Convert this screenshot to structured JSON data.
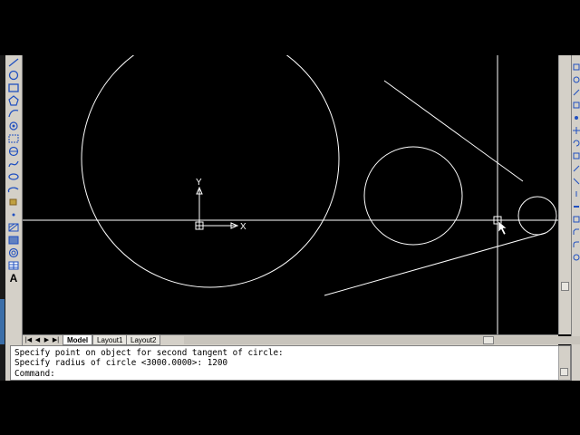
{
  "layout_tabs": {
    "model": "Model",
    "layout1": "Layout1",
    "layout2": "Layout2"
  },
  "ucs": {
    "x_label": "X",
    "y_label": "Y"
  },
  "command_window": {
    "line1": "Specify point on object for second tangent of circle:",
    "line2": "Specify radius of circle <3000.0000>: 1200",
    "line3": "Command:"
  },
  "toolbar": {
    "text_tool": "A"
  },
  "icons": {
    "left_toolbar": [
      "line-icon",
      "circle-icon",
      "rectangle-icon",
      "polygon-icon",
      "arc-icon",
      "revision-cloud-icon",
      "spline-icon",
      "ellipse-icon",
      "ellipse-arc-icon",
      "insert-block-icon",
      "make-block-icon",
      "point-icon",
      "hatch-icon",
      "gradient-icon",
      "region-icon",
      "table-icon",
      "multiline-text-icon"
    ]
  },
  "colors": {
    "canvas": "#000000",
    "geometry": "#ffffff",
    "chrome": "#d4d0c8"
  }
}
